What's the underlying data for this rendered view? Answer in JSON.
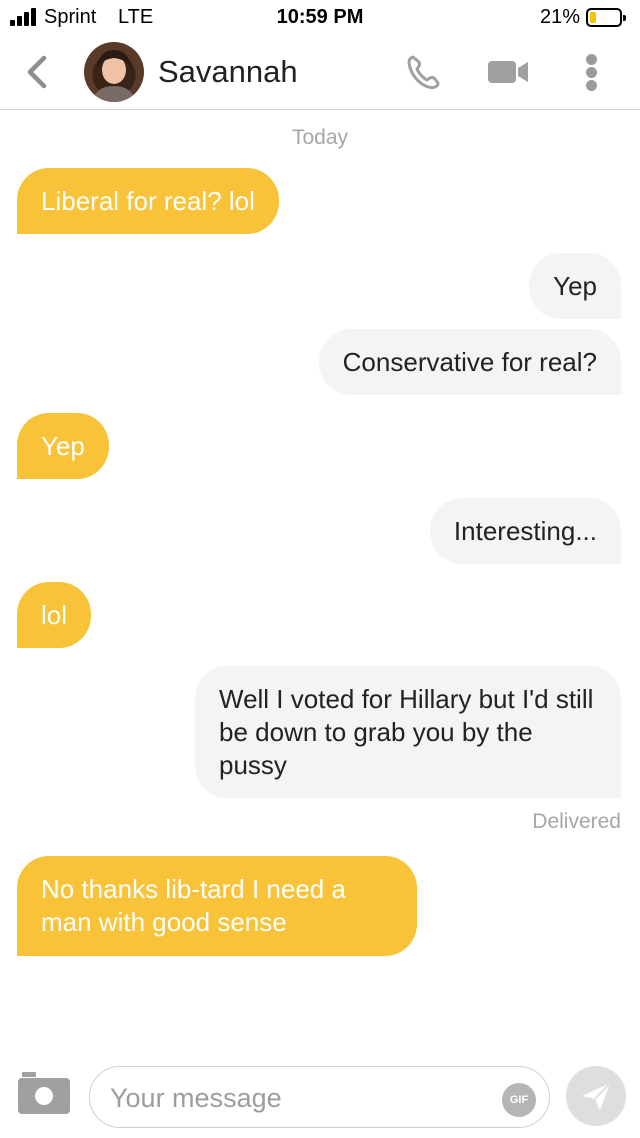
{
  "status_bar": {
    "carrier": "Sprint",
    "network": "LTE",
    "time": "10:59 PM",
    "battery_percent": "21%",
    "battery_level": 0.21
  },
  "header": {
    "contact_name": "Savannah",
    "icons": [
      "chevron-left-icon",
      "avatar",
      "phone-icon",
      "video-camera-icon",
      "more-vertical-icon"
    ]
  },
  "conversation": {
    "day_label": "Today",
    "messages": [
      {
        "direction": "incoming",
        "text": "Liberal for real? lol"
      },
      {
        "direction": "outgoing",
        "text": "Yep"
      },
      {
        "direction": "outgoing",
        "text": "Conservative for real?"
      },
      {
        "direction": "incoming",
        "text": "Yep"
      },
      {
        "direction": "outgoing",
        "text": "Interesting..."
      },
      {
        "direction": "incoming",
        "text": "lol"
      },
      {
        "direction": "outgoing",
        "text": "Well I voted for Hillary but I'd still be down to grab you by the pussy"
      },
      {
        "direction": "incoming",
        "text": "No thanks lib-tard I need a man with good sense"
      }
    ],
    "delivered_label": "Delivered"
  },
  "composer": {
    "placeholder": "Your message",
    "value": "",
    "gif_label": "GIF",
    "icons": [
      "camera-icon",
      "gif-icon",
      "send-icon"
    ]
  },
  "colors": {
    "incoming_bubble": "#f8c338",
    "outgoing_bubble": "#f4f4f4",
    "meta_text": "#a6a6a6",
    "battery_fill": "#f5c400"
  }
}
